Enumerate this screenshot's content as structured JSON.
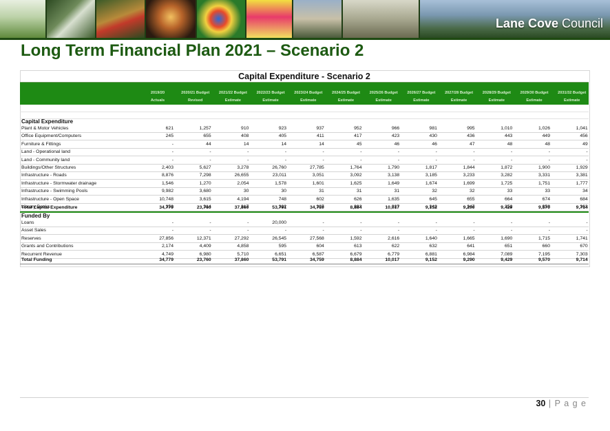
{
  "header": {
    "brand_bold": "Lane Cove",
    "brand_rest": " Council",
    "colors": {
      "banner": "#1f3d14",
      "title_green": "#1d5a12",
      "table_header_green": "#1e8a14"
    }
  },
  "document": {
    "title": "Long Term Financial Plan 2021 – Scenario 2",
    "page_number": "30",
    "page_separator": "|",
    "page_label": "P a g e"
  },
  "table": {
    "title": "Capital Expenditure  - Scenario 2",
    "columns": [
      {
        "year": "2019/20",
        "type": "Actuals"
      },
      {
        "year": "2020/21 Budget",
        "type": "Revised"
      },
      {
        "year": "2021/22 Budget",
        "type": "Estimate"
      },
      {
        "year": "2022/23 Budget",
        "type": "Estimate"
      },
      {
        "year": "2023/24 Budget",
        "type": "Estimate"
      },
      {
        "year": "2024/25 Budget",
        "type": "Estimate"
      },
      {
        "year": "2025/26 Budget",
        "type": "Estimate"
      },
      {
        "year": "2026/27 Budget",
        "type": "Estimate"
      },
      {
        "year": "2027/28 Budget",
        "type": "Estimate"
      },
      {
        "year": "2028/29 Budget",
        "type": "Estimate"
      },
      {
        "year": "2029/30 Budget",
        "type": "Estimate"
      },
      {
        "year": "2031/32 Budget",
        "type": "Estimate"
      }
    ],
    "capex_heading": "Capital Expenditure",
    "capex_rows": [
      {
        "label": "Plant & Motor Vehicles",
        "values": [
          "621",
          "1,257",
          "910",
          "923",
          "937",
          "952",
          "966",
          "981",
          "995",
          "1,010",
          "1,026",
          "1,041"
        ]
      },
      {
        "label": "Office Equipment/Computers",
        "values": [
          "245",
          "655",
          "408",
          "405",
          "411",
          "417",
          "423",
          "430",
          "436",
          "443",
          "449",
          "456"
        ]
      },
      {
        "label": "Furniture & Fittings",
        "values": [
          "-",
          "44",
          "14",
          "14",
          "14",
          "45",
          "46",
          "46",
          "47",
          "48",
          "48",
          "49"
        ]
      },
      {
        "label": "Land - Operational land",
        "values": [
          "-",
          "-",
          "-",
          "-",
          "-",
          "-",
          "-",
          "-",
          "-",
          "-",
          "-",
          "-"
        ]
      },
      {
        "label": "Land - Community land",
        "values": [
          "-",
          "-",
          "-",
          "-",
          "-",
          "-",
          "-",
          "-",
          "-",
          "-",
          "-",
          "-"
        ]
      },
      {
        "label": "Buildings/Other Structures",
        "values": [
          "2,403",
          "5,627",
          "3,278",
          "26,760",
          "27,785",
          "1,764",
          "1,790",
          "1,817",
          "1,844",
          "1,872",
          "1,900",
          "1,929"
        ]
      },
      {
        "label": "Infrastructure - Roads",
        "values": [
          "8,876",
          "7,298",
          "26,655",
          "23,011",
          "3,051",
          "3,092",
          "3,138",
          "3,185",
          "3,233",
          "3,282",
          "3,331",
          "3,381"
        ]
      },
      {
        "label": "Infrastructure - Stormwater drainage",
        "values": [
          "1,546",
          "1,270",
          "2,054",
          "1,578",
          "1,601",
          "1,625",
          "1,649",
          "1,674",
          "1,699",
          "1,725",
          "1,751",
          "1,777"
        ]
      },
      {
        "label": "Infrastructure - Swimming Pools",
        "values": [
          "9,982",
          "3,680",
          "30",
          "30",
          "31",
          "31",
          "31",
          "32",
          "32",
          "33",
          "33",
          "34"
        ]
      },
      {
        "label": "Infrastructure - Open Space",
        "values": [
          "10,748",
          "3,615",
          "4,194",
          "748",
          "602",
          "626",
          "1,635",
          "645",
          "655",
          "664",
          "674",
          "684"
        ]
      },
      {
        "label": "Library Books",
        "values": [
          "358",
          "314",
          "317",
          "322",
          "327",
          "332",
          "337",
          "342",
          "347",
          "352",
          "358",
          "363"
        ]
      }
    ],
    "capex_total": {
      "label": "Total Capital Expenditure",
      "values": [
        "34,779",
        "23,760",
        "37,860",
        "53,791",
        "34,759",
        "8,884",
        "10,017",
        "9,152",
        "9,290",
        "9,429",
        "9,570",
        "9,714"
      ]
    },
    "funding_heading": "Funded By",
    "funding_rows": [
      {
        "label": "Loans",
        "values": [
          "-",
          "-",
          "-",
          "20,000",
          "-",
          "-",
          "-",
          "-",
          "-",
          "-",
          "-",
          "-"
        ]
      },
      {
        "label": "Asset Sales",
        "values": [
          "-",
          "-",
          "-",
          "-",
          "-",
          "-",
          "-",
          "-",
          "-",
          "-",
          "-",
          "-"
        ]
      },
      {
        "label": "Reserves",
        "values": [
          "27,856",
          "12,371",
          "27,292",
          "26,545",
          "27,568",
          "1,592",
          "2,616",
          "1,640",
          "1,665",
          "1,690",
          "1,715",
          "1,741"
        ]
      },
      {
        "label": "Grants and Contributions",
        "values": [
          "2,174",
          "4,409",
          "4,858",
          "595",
          "604",
          "613",
          "622",
          "632",
          "641",
          "651",
          "660",
          "670"
        ]
      },
      {
        "label": "Recurrent Revenue",
        "values": [
          "4,749",
          "6,980",
          "5,710",
          "6,651",
          "6,587",
          "6,679",
          "6,779",
          "6,881",
          "6,984",
          "7,089",
          "7,195",
          "7,303"
        ]
      }
    ],
    "funding_total": {
      "label": "Total Funding",
      "values": [
        "34,779",
        "23,760",
        "37,860",
        "53,791",
        "34,759",
        "8,884",
        "10,017",
        "9,152",
        "9,290",
        "9,429",
        "9,570",
        "9,714"
      ]
    }
  }
}
